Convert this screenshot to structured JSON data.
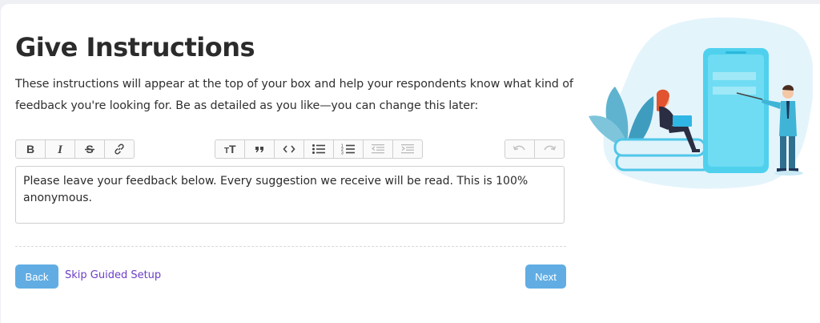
{
  "page": {
    "title": "Give Instructions",
    "description": "These instructions will appear at the top of your box and help your respondents know what kind of feedback you're looking for. Be as detailed as you like—you can change this later:"
  },
  "toolbar": {
    "groups": [
      [
        "bold-icon",
        "italic-icon",
        "strikethrough-icon",
        "link-icon"
      ],
      [
        "heading-icon",
        "quote-icon",
        "code-icon",
        "bullet-list-icon",
        "numbered-list-icon",
        "outdent-icon",
        "indent-icon"
      ],
      [
        "undo-icon",
        "redo-icon"
      ]
    ]
  },
  "editor": {
    "value": "Please leave your feedback below. Every suggestion we receive will be read. This is 100% anonymous."
  },
  "actions": {
    "back_label": "Back",
    "skip_label": "Skip Guided Setup",
    "next_label": "Next"
  },
  "colors": {
    "primary_button": "#61ade3",
    "link": "#6b3fc7",
    "illustration_blob": "#e4f4fb",
    "illustration_phone": "#4fd1ee"
  }
}
